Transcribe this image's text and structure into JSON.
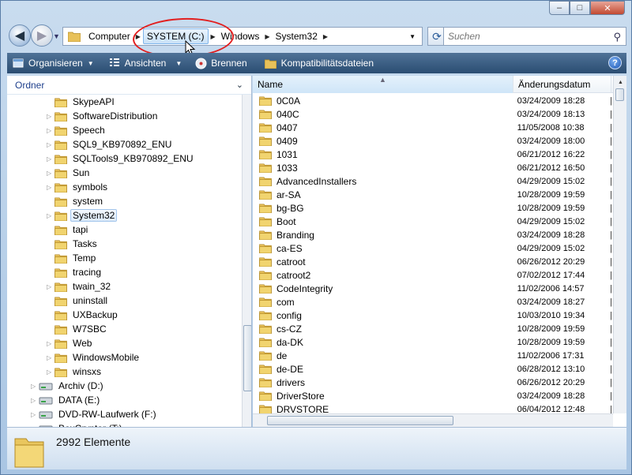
{
  "window": {
    "min_label": "–",
    "max_label": "□",
    "close_label": "✕"
  },
  "address": {
    "crumbs": [
      "Computer",
      "SYSTEM (C:)",
      "Windows",
      "System32"
    ]
  },
  "search": {
    "placeholder": "Suchen"
  },
  "toolbar": {
    "organize": "Organisieren",
    "views": "Ansichten",
    "burn": "Brennen",
    "compat": "Kompatibilitätsdateien"
  },
  "nav_pane": {
    "header": "Ordner",
    "items": [
      {
        "label": "SkypeAPI",
        "expand": false
      },
      {
        "label": "SoftwareDistribution",
        "expand": true
      },
      {
        "label": "Speech",
        "expand": true
      },
      {
        "label": "SQL9_KB970892_ENU",
        "expand": true
      },
      {
        "label": "SQLTools9_KB970892_ENU",
        "expand": true
      },
      {
        "label": "Sun",
        "expand": true
      },
      {
        "label": "symbols",
        "expand": true
      },
      {
        "label": "system",
        "expand": false
      },
      {
        "label": "System32",
        "expand": true,
        "selected": true
      },
      {
        "label": "tapi",
        "expand": false
      },
      {
        "label": "Tasks",
        "expand": false
      },
      {
        "label": "Temp",
        "expand": false
      },
      {
        "label": "tracing",
        "expand": false
      },
      {
        "label": "twain_32",
        "expand": true
      },
      {
        "label": "uninstall",
        "expand": false
      },
      {
        "label": "UXBackup",
        "expand": false
      },
      {
        "label": "W7SBC",
        "expand": false
      },
      {
        "label": "Web",
        "expand": true
      },
      {
        "label": "WindowsMobile",
        "expand": true
      },
      {
        "label": "winsxs",
        "expand": true
      }
    ],
    "drives": [
      {
        "label": "Archiv (D:)"
      },
      {
        "label": "DATA (E:)"
      },
      {
        "label": "DVD-RW-Laufwerk (F:)"
      },
      {
        "label": "BoxCryptor (T:)"
      }
    ]
  },
  "columns": {
    "name": "Name",
    "date": "Änderungsdatum"
  },
  "files": [
    {
      "name": "0C0A",
      "date": "03/24/2009 18:28"
    },
    {
      "name": "040C",
      "date": "03/24/2009 18:13"
    },
    {
      "name": "0407",
      "date": "11/05/2008 10:38"
    },
    {
      "name": "0409",
      "date": "03/24/2009 18:00"
    },
    {
      "name": "1031",
      "date": "06/21/2012 16:22"
    },
    {
      "name": "1033",
      "date": "06/21/2012 16:50"
    },
    {
      "name": "AdvancedInstallers",
      "date": "04/29/2009 15:02"
    },
    {
      "name": "ar-SA",
      "date": "10/28/2009 19:59"
    },
    {
      "name": "bg-BG",
      "date": "10/28/2009 19:59"
    },
    {
      "name": "Boot",
      "date": "04/29/2009 15:02"
    },
    {
      "name": "Branding",
      "date": "03/24/2009 18:28"
    },
    {
      "name": "ca-ES",
      "date": "04/29/2009 15:02"
    },
    {
      "name": "catroot",
      "date": "06/26/2012 20:29"
    },
    {
      "name": "catroot2",
      "date": "07/02/2012 17:44"
    },
    {
      "name": "CodeIntegrity",
      "date": "11/02/2006 14:57"
    },
    {
      "name": "com",
      "date": "03/24/2009 18:27"
    },
    {
      "name": "config",
      "date": "10/03/2010 19:34"
    },
    {
      "name": "cs-CZ",
      "date": "10/28/2009 19:59"
    },
    {
      "name": "da-DK",
      "date": "10/28/2009 19:59"
    },
    {
      "name": "de",
      "date": "11/02/2006 17:31"
    },
    {
      "name": "de-DE",
      "date": "06/28/2012 13:10"
    },
    {
      "name": "drivers",
      "date": "06/26/2012 20:29"
    },
    {
      "name": "DriverStore",
      "date": "03/24/2009 18:28"
    },
    {
      "name": "DRVSTORE",
      "date": "06/04/2012 12:48"
    }
  ],
  "details": {
    "count": "2992 Elemente"
  },
  "colors": {
    "annotation": "#e21f1f",
    "toolbar": "#3b5f86"
  }
}
